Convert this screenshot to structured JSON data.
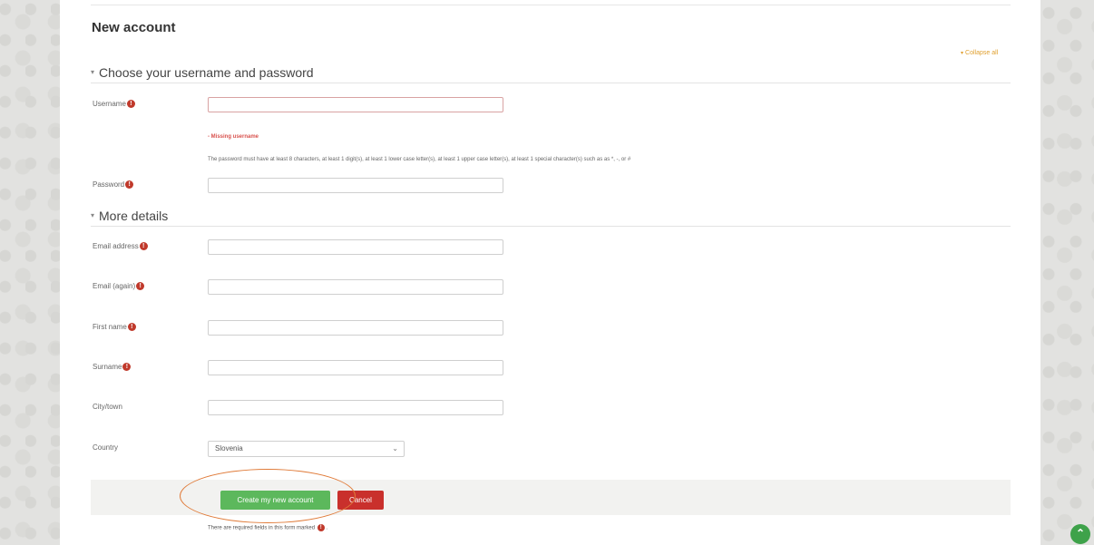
{
  "page": {
    "title": "New account",
    "collapse_all": "Collapse all"
  },
  "sections": {
    "credentials": "Choose your username and password",
    "details": "More details"
  },
  "icons": {
    "required": "!",
    "collapse_caret": "▾",
    "section_caret": "▾",
    "select_chevron": "⌄",
    "scroll_top": "⌃"
  },
  "fields": {
    "username": {
      "label": "Username",
      "value": "",
      "error": "- Missing username"
    },
    "password_rules": "The password must have at least 8 characters, at least 1 digit(s), at least 1 lower case letter(s), at least 1 upper case letter(s), at least 1 special character(s) such as as *, -, or #",
    "password": {
      "label": "Password",
      "value": ""
    },
    "email": {
      "label": "Email address",
      "value": ""
    },
    "email_again": {
      "label": "Email (again)",
      "value": ""
    },
    "first_name": {
      "label": "First name",
      "value": ""
    },
    "surname": {
      "label": "Surname",
      "value": ""
    },
    "city": {
      "label": "City/town",
      "value": ""
    },
    "country": {
      "label": "Country",
      "value": "Slovenia"
    }
  },
  "buttons": {
    "create": "Create my new account",
    "cancel": "Cancel"
  },
  "footer": {
    "required_note_prefix": "There are required fields in this form marked",
    "required_note_suffix": "."
  },
  "colors": {
    "required": "#c0392b",
    "create_button": "#5cb85c",
    "cancel_button": "#c9302c",
    "error_text": "#d9534f",
    "collapse_link": "#e0a030",
    "annotation": "#e07b39",
    "scroll_top": "#3ea24a"
  }
}
